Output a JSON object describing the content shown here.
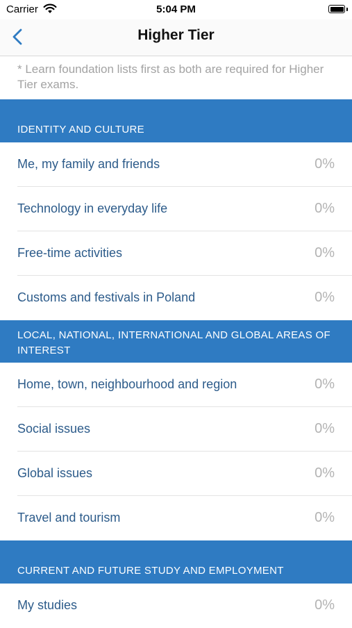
{
  "status_bar": {
    "carrier": "Carrier",
    "time": "5:04 PM"
  },
  "nav": {
    "title": "Higher Tier"
  },
  "note": "* Learn foundation lists first as both are required for Higher Tier exams.",
  "sections": [
    {
      "title": "IDENTITY AND CULTURE",
      "items": [
        {
          "label": "Me, my family and friends",
          "progress": "0%"
        },
        {
          "label": "Technology in everyday life",
          "progress": "0%"
        },
        {
          "label": "Free-time activities",
          "progress": "0%"
        },
        {
          "label": "Customs and festivals in Poland",
          "progress": "0%"
        }
      ]
    },
    {
      "title": "LOCAL, NATIONAL, INTERNATIONAL AND GLOBAL AREAS OF INTEREST",
      "items": [
        {
          "label": "Home, town, neighbourhood and region",
          "progress": "0%"
        },
        {
          "label": "Social issues",
          "progress": "0%"
        },
        {
          "label": "Global issues",
          "progress": "0%"
        },
        {
          "label": "Travel and tourism",
          "progress": "0%"
        }
      ]
    },
    {
      "title": "CURRENT AND FUTURE STUDY AND EMPLOYMENT",
      "items": [
        {
          "label": "My studies",
          "progress": "0%"
        }
      ]
    }
  ],
  "colors": {
    "accent": "#2f7bc2",
    "label": "#2c5b8a",
    "muted": "#b3b3b3"
  },
  "icons": {
    "back": "chevron-left-icon",
    "wifi": "wifi-icon",
    "battery": "battery-icon"
  }
}
